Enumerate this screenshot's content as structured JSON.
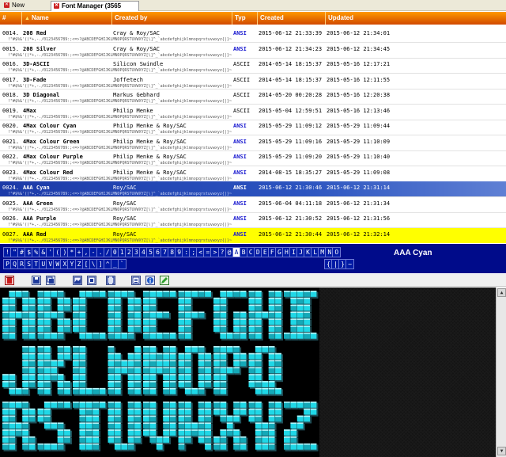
{
  "tabs": [
    {
      "label": "New",
      "active": false
    },
    {
      "label": "Font Manager (3565 Fonts)",
      "active": true
    }
  ],
  "columns": [
    "#",
    "Name",
    "Created by",
    "Typ",
    "Created",
    "Updated"
  ],
  "sample_text": "!\"#$%&'()*+,-./0123456789:;<=>?@ABCDEFGHIJKLMNOPQRSTUVWXYZ[\\]^_`abcdefghijklmnopqrstuvwxyz{|}~",
  "rows": [
    {
      "num": "0014.",
      "name": "208 Red",
      "author": "Cray & Roy/SAC",
      "type": "ANSI",
      "created": "2015-06-12 21:33:39",
      "updated": "2015-06-12 21:34:01"
    },
    {
      "num": "0015.",
      "name": "208 Silver",
      "author": "Cray & Roy/SAC",
      "type": "ANSI",
      "created": "2015-06-12 21:34:23",
      "updated": "2015-06-12 21:34:45"
    },
    {
      "num": "0016.",
      "name": "3D-ASCII",
      "author": "Silicon Swindle",
      "type": "ASCII",
      "created": "2014-05-14 18:15:37",
      "updated": "2015-05-16 12:17:21"
    },
    {
      "num": "0017.",
      "name": "3D-Fade",
      "author": "Joffetech",
      "type": "ASCII",
      "created": "2014-05-14 18:15:37",
      "updated": "2015-05-16 12:11:55"
    },
    {
      "num": "0018.",
      "name": "3D Diagonal",
      "author": "Markus Gebhard",
      "type": "ASCII",
      "created": "2014-05-20 00:20:28",
      "updated": "2015-05-16 12:20:38"
    },
    {
      "num": "0019.",
      "name": "4Max",
      "author": "Philip Menke",
      "type": "ASCII",
      "created": "2015-05-04 12:59:51",
      "updated": "2015-05-16 12:13:46"
    },
    {
      "num": "0020.",
      "name": "4Max Colour Cyan",
      "author": "Philip Menke & Roy/SAC",
      "type": "ANSI",
      "created": "2015-05-29 11:09:12",
      "updated": "2015-05-29 11:09:44"
    },
    {
      "num": "0021.",
      "name": "4Max Colour Green",
      "author": "Philip Menke & Roy/SAC",
      "type": "ANSI",
      "created": "2015-05-29 11:09:16",
      "updated": "2015-05-29 11:10:09"
    },
    {
      "num": "0022.",
      "name": "4Max Colour Purple",
      "author": "Philip Menke & Roy/SAC",
      "type": "ANSI",
      "created": "2015-05-29 11:09:20",
      "updated": "2015-05-29 11:10:40"
    },
    {
      "num": "0023.",
      "name": "4Max Colour Red",
      "author": "Philip Menke & Roy/SAC",
      "type": "ANSI",
      "created": "2014-08-15 18:35:27",
      "updated": "2015-05-29 11:09:08"
    },
    {
      "num": "0024.",
      "name": "AAA Cyan",
      "author": "Roy/SAC",
      "type": "ANSI",
      "created": "2015-06-12 21:30:46",
      "updated": "2015-06-12 21:31:14",
      "state": "selected"
    },
    {
      "num": "0025.",
      "name": "AAA Green",
      "author": "Roy/SAC",
      "type": "ANSI",
      "created": "2015-06-04 04:11:18",
      "updated": "2015-06-12 21:31:34"
    },
    {
      "num": "0026.",
      "name": "AAA Purple",
      "author": "Roy/SAC",
      "type": "ANSI",
      "created": "2015-06-12 21:30:52",
      "updated": "2015-06-12 21:31:56"
    },
    {
      "num": "0027.",
      "name": "AAA Red",
      "author": "Roy/SAC",
      "type": "ANSI",
      "created": "2015-06-12 21:30:44",
      "updated": "2015-06-12 21:32:14",
      "state": "highlight"
    }
  ],
  "char_keys_row1": [
    "!",
    "\"",
    "#",
    "$",
    "%",
    "&",
    "'",
    "(",
    ")",
    "*",
    "+",
    ",",
    "-",
    ".",
    "/",
    "0",
    "1",
    "2",
    "3",
    "4",
    "5",
    "6",
    "7",
    "8",
    "9",
    ":",
    ";",
    "<",
    "=",
    ">",
    "?",
    "@",
    "A",
    "B",
    "C",
    "D",
    "E",
    "F",
    "G",
    "H",
    "I",
    "J",
    "K",
    "L",
    "M",
    "N",
    "O"
  ],
  "char_keys_row2": [
    "P",
    "Q",
    "R",
    "S",
    "T",
    "U",
    "V",
    "W",
    "X",
    "Y",
    "Z",
    "[",
    "\\",
    "]",
    "^",
    "_",
    "`"
  ],
  "char_keys_row2_right": [
    "{",
    "|",
    "}",
    "~"
  ],
  "selected_key": "A",
  "preview": {
    "font_name": "AAA Cyan",
    "lines": [
      "ABCDEFGHI",
      "JKLMNOPQ",
      "RSTUVWXYZ"
    ]
  },
  "toolbar_icons": [
    "delete-icon",
    "save-icon",
    "copy-icon",
    "image-icon",
    "export-icon",
    "brackets-icon",
    "list-icon",
    "info-icon",
    "edit-icon"
  ],
  "colors": {
    "header_top": "#ff9a00",
    "header_bottom": "#d14a00",
    "selection": "#1c3aa8",
    "highlight": "#ffff00",
    "ansi_type": "#1a1ad0",
    "char_panel": "#000b8a",
    "preview_cyan": "#1fd7e6"
  }
}
